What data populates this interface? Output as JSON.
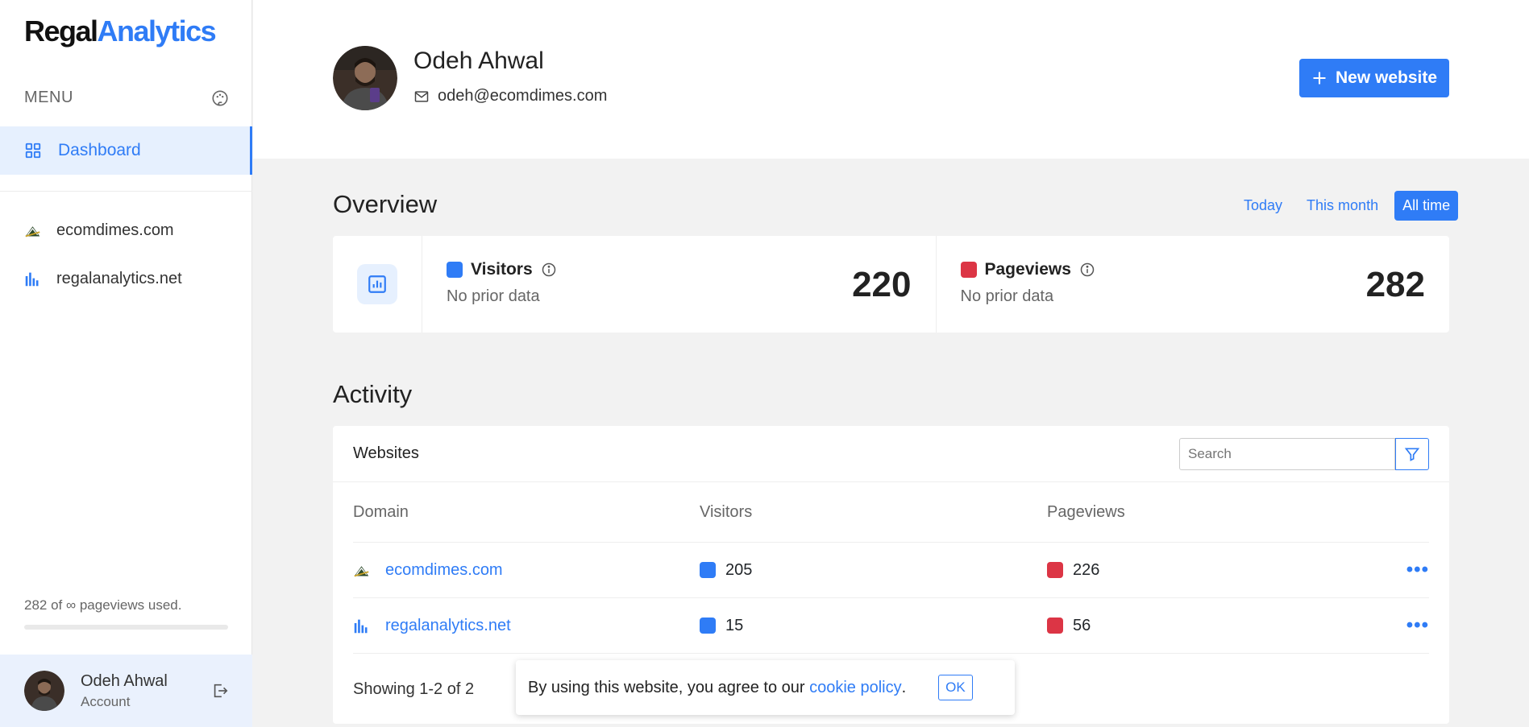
{
  "brand": {
    "part1": "Regal",
    "part2": "Analytics",
    "accent": "#2f7cf6"
  },
  "sidebar": {
    "menu_label": "MENU",
    "dashboard_label": "Dashboard",
    "sites": [
      {
        "label": "ecomdimes.com",
        "icon": "ecomdimes-logo-icon"
      },
      {
        "label": "regalanalytics.net",
        "icon": "bar-chart-icon"
      }
    ],
    "usage_text": "282 of ∞ pageviews used.",
    "usage_fraction": 0.0,
    "account_name": "Odeh Ahwal",
    "account_sub": "Account"
  },
  "header": {
    "name": "Odeh Ahwal",
    "email": "odeh@ecomdimes.com",
    "new_website_label": "New website"
  },
  "overview": {
    "title": "Overview",
    "ranges": [
      "Today",
      "This month",
      "All time"
    ],
    "active_range": "All time",
    "visitors": {
      "label": "Visitors",
      "sub": "No prior data",
      "value": "220",
      "color": "#2f7cf6"
    },
    "pageviews": {
      "label": "Pageviews",
      "sub": "No prior data",
      "value": "282",
      "color": "#dc3545"
    }
  },
  "activity": {
    "title": "Activity",
    "card_title": "Websites",
    "search_placeholder": "Search",
    "columns": [
      "Domain",
      "Visitors",
      "Pageviews"
    ],
    "rows": [
      {
        "domain": "ecomdimes.com",
        "visitors": "205",
        "pageviews": "226"
      },
      {
        "domain": "regalanalytics.net",
        "visitors": "15",
        "pageviews": "56"
      }
    ],
    "showing": "Showing 1-2 of 2"
  },
  "cookie": {
    "text": "By using this website, you agree to our ",
    "link": "cookie policy",
    "after": ".",
    "ok": "OK"
  }
}
